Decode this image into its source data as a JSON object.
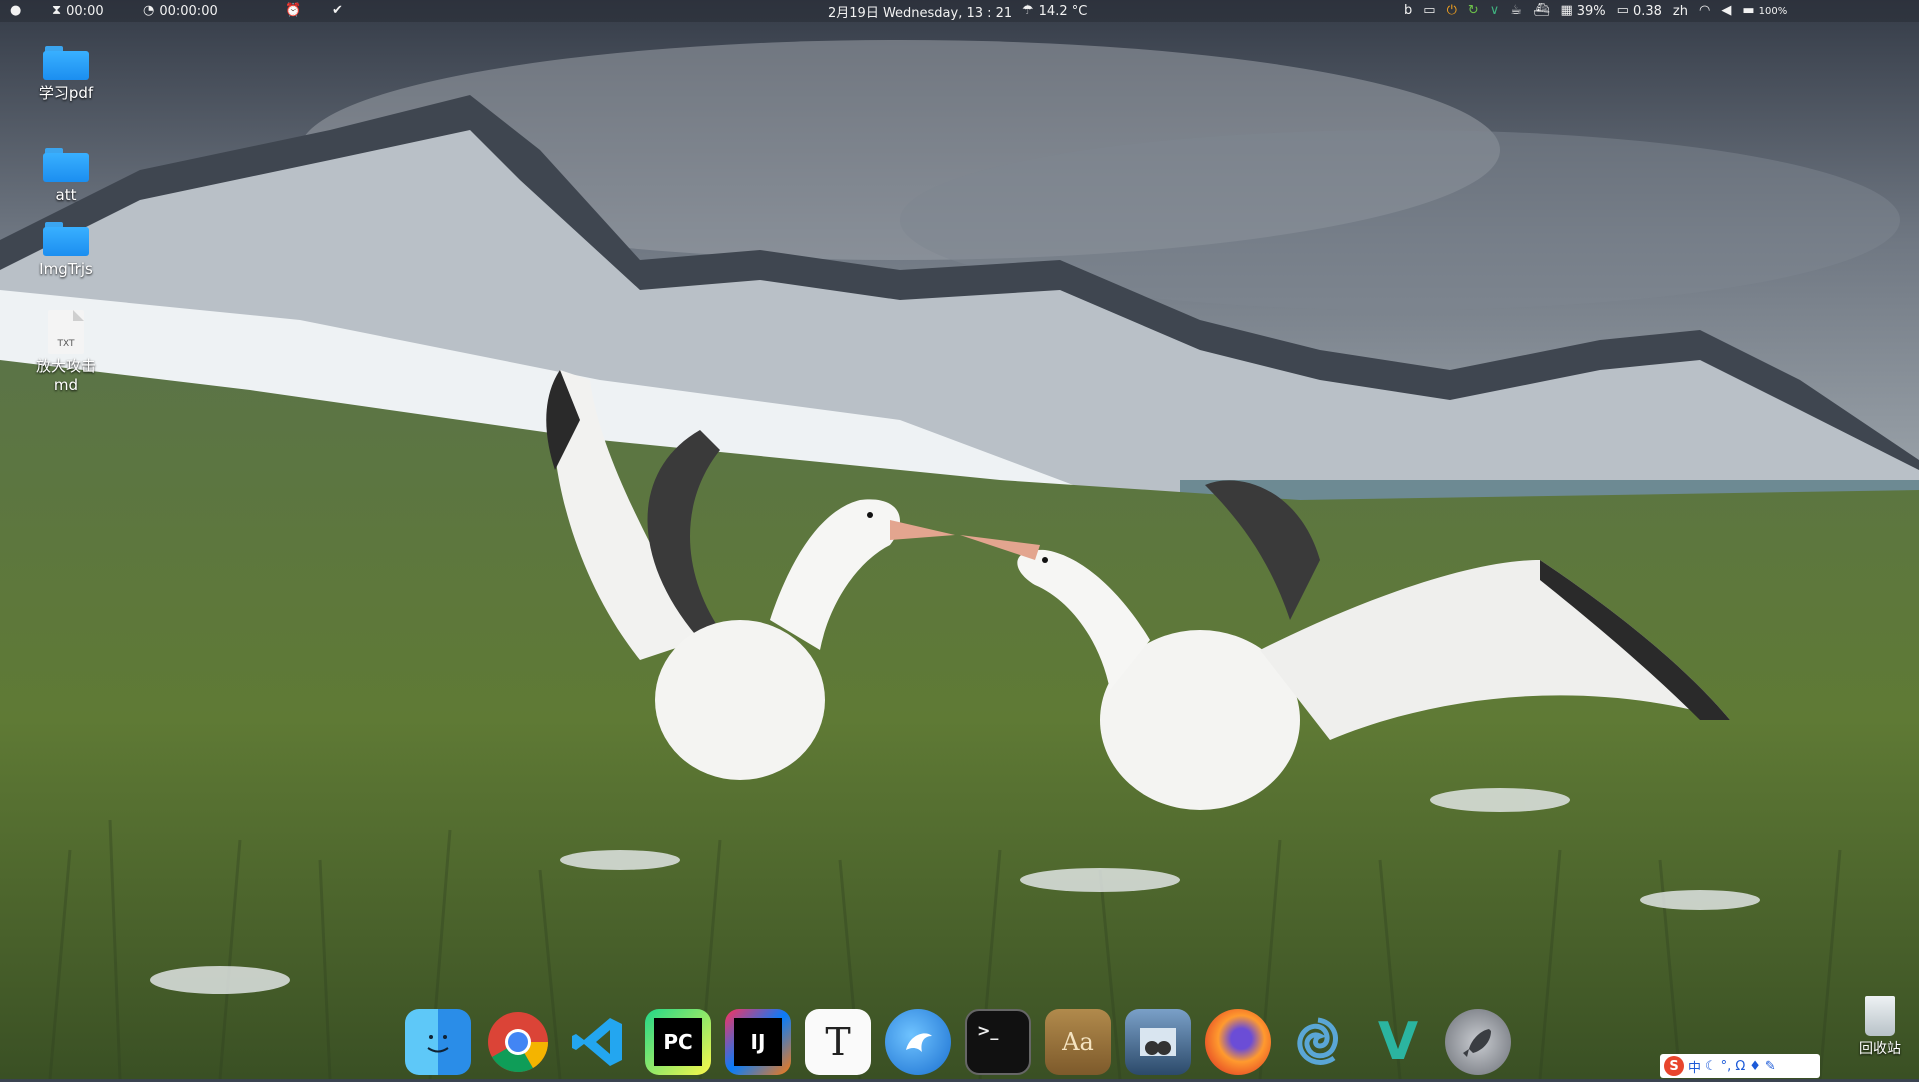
{
  "menubar": {
    "apple_icon": "apple-icon",
    "timer_icon": "hourglass-icon",
    "timer_value": "00:00",
    "stopwatch_icon": "stopwatch-icon",
    "stopwatch_value": "00:00:00",
    "alarm_icon": "alarm-icon",
    "check_icon": "check-icon",
    "datetime": "2月19日 Wednesday, 13 : 21",
    "weather_icon": "weather-icon",
    "temperature": "14.2 °C",
    "tray": {
      "bing_icon": "bing-icon",
      "keyboard_icon": "keyboard-icon",
      "app_icons": [
        "power-icon",
        "refresh-icon",
        "vue-icon",
        "cup-icon",
        "docker-icon"
      ],
      "cpu_icon": "cpu-icon",
      "cpu_value": "39%",
      "display_icon": "monitor-icon",
      "load_value": "0.38",
      "lang": "zh",
      "wifi_icon": "wifi-icon",
      "volume_icon": "volume-icon",
      "battery_icon": "battery-icon",
      "battery_value": "100%"
    }
  },
  "desktop": {
    "icons": [
      {
        "name": "学习pdf",
        "type": "folder"
      },
      {
        "name": "att",
        "type": "folder"
      },
      {
        "name": "ImgTrjs",
        "type": "folder"
      },
      {
        "name": "放大攻击\nmd",
        "type": "txt",
        "badge": "TXT"
      }
    ]
  },
  "dock": {
    "apps": [
      {
        "name": "finder-icon",
        "glyph": ""
      },
      {
        "name": "chrome-icon",
        "glyph": ""
      },
      {
        "name": "vscode-icon",
        "glyph": ""
      },
      {
        "name": "pycharm-icon",
        "glyph": "PC"
      },
      {
        "name": "intellij-icon",
        "glyph": "IJ"
      },
      {
        "name": "typora-icon",
        "glyph": "T"
      },
      {
        "name": "eagle-icon",
        "glyph": ""
      },
      {
        "name": "terminal-icon",
        "glyph": ">_"
      },
      {
        "name": "dictionary-icon",
        "glyph": "Aa"
      },
      {
        "name": "preview-icon",
        "glyph": ""
      },
      {
        "name": "firefox-icon",
        "glyph": ""
      },
      {
        "name": "spiral-app-icon",
        "glyph": ""
      },
      {
        "name": "vim-icon",
        "glyph": "V"
      },
      {
        "name": "launchpad-icon",
        "glyph": ""
      }
    ]
  },
  "ime": {
    "logo": "S",
    "lang": "中",
    "icons": [
      "moon-icon",
      "punctuation-icon",
      "omega-icon",
      "shirt-icon",
      "wrench-icon"
    ]
  },
  "trash": {
    "label": "回收站",
    "icon": "trash-icon"
  },
  "colors": {
    "folder": "#1b8ef0",
    "menubar": "#282c34"
  }
}
